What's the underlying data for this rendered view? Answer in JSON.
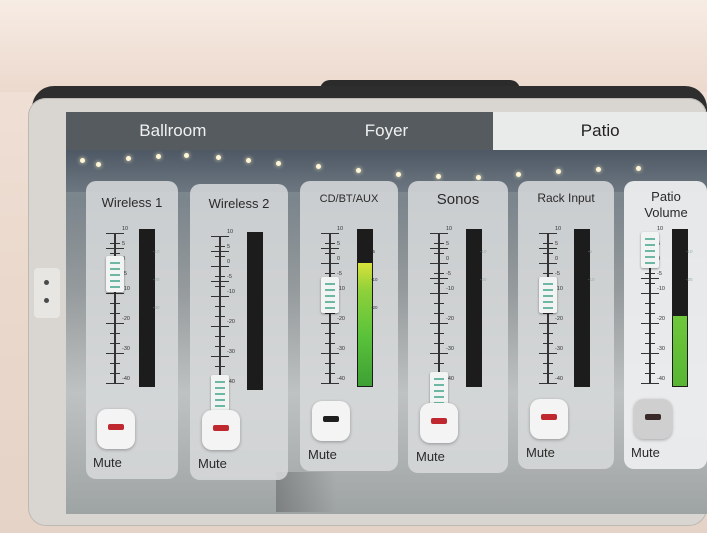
{
  "tabs": [
    {
      "label": "Ballroom",
      "active": false
    },
    {
      "label": "Foyer",
      "active": false
    },
    {
      "label": "Patio",
      "active": true
    }
  ],
  "channels": [
    {
      "name": "Wireless 1",
      "fader_db": -3,
      "meter_level": 0,
      "mute_color": "#c0282f",
      "scale_labels": [
        "10",
        "5",
        "0",
        "-5",
        "-10",
        "-20",
        "-30",
        "-40"
      ],
      "meter_labels": [
        "-10",
        "-20",
        "-30"
      ]
    },
    {
      "name": "Wireless 2",
      "fader_db": -60,
      "meter_level": 0,
      "mute_color": "#c0282f",
      "scale_labels": [
        "10",
        "5",
        "0",
        "-5",
        "-10",
        "-20",
        "-30",
        "-40"
      ],
      "meter_labels": []
    },
    {
      "name": "CD/BT/AUX",
      "fader_db": -10,
      "meter_level": 0.79,
      "mute_color": "#1e1e1e",
      "scale_labels": [
        "10",
        "5",
        "0",
        "-5",
        "-10",
        "-20",
        "-30",
        "-40"
      ],
      "meter_labels": [
        "-5",
        "-10",
        "-20"
      ]
    },
    {
      "name": "Sonos",
      "fader_db": -60,
      "meter_level": 0,
      "mute_color": "#c0282f",
      "scale_labels": [
        "10",
        "5",
        "0",
        "-5",
        "-10",
        "-20",
        "-30",
        "-40"
      ],
      "meter_labels": [
        "-10",
        "-20"
      ]
    },
    {
      "name": "Rack Input",
      "fader_db": -10,
      "meter_level": 0,
      "mute_color": "#c0282f",
      "scale_labels": [
        "10",
        "5",
        "0",
        "-5",
        "-10",
        "-20",
        "-30",
        "-40"
      ],
      "meter_labels": [
        "-5",
        "-10"
      ]
    },
    {
      "name": "Patio Volume",
      "fader_db": 5,
      "meter_level": 0.45,
      "mute_color": "#3a2a2a",
      "scale_labels": [
        "10",
        "5",
        "0",
        "-5",
        "-10",
        "-20",
        "-30",
        "-40"
      ],
      "meter_labels": [
        "-10",
        "-20"
      ]
    }
  ],
  "mute_label": "Mute",
  "icons": [
    "mute-indicator-icon",
    "fader-thumb-icon"
  ]
}
